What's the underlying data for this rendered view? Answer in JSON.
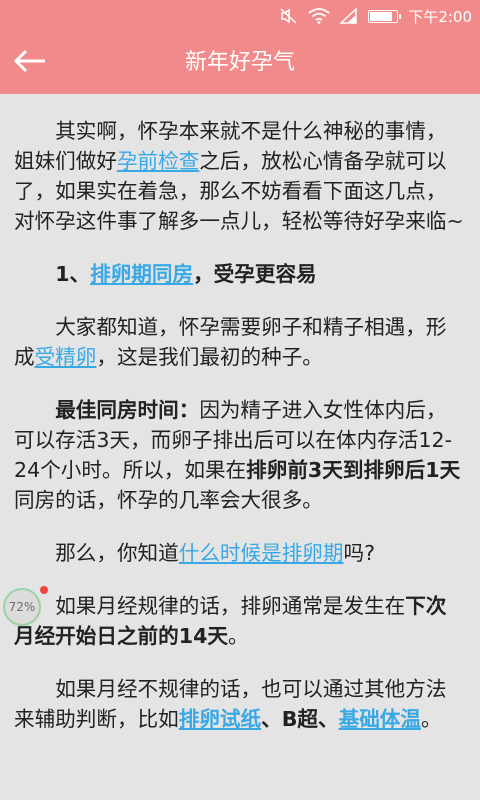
{
  "status_bar": {
    "time": "下午2:00",
    "icons": [
      "mute-icon",
      "wifi-icon",
      "signal-icon",
      "battery-icon"
    ]
  },
  "app_bar": {
    "title": "新年好孕气",
    "back_icon": "back-arrow-icon",
    "background": "#f18a8a"
  },
  "article": {
    "p1": {
      "a": "其实啊，怀孕本来就不是什么神秘的事情，姐妹们做好",
      "link": "孕前检查",
      "b": "之后，放松心情备孕就可以了，如果实在着急，那么不妨看看下面这几点，对怀孕这件事了解多一点儿，轻松等待好孕来临~"
    },
    "h1": {
      "prefix": "1、",
      "link": "排卵期同房",
      "suffix": "，受孕更容易"
    },
    "p2": {
      "a": "大家都知道，怀孕需要卵子和精子相遇，形成",
      "link": "受精卵",
      "b": "，这是我们最初的种子。"
    },
    "p3": {
      "bold1": "最佳同房时间：",
      "a": "因为精子进入女性体内后，可以存活3天，而卵子排出后可以在体内存活12-24个小时。所以，如果在",
      "bold2": "排卵前3天到排卵后1天",
      "b": "同房的话，怀孕的几率会大很多。"
    },
    "p4": {
      "a": "那么，你知道",
      "link": "什么时候是排卵期",
      "b": "吗?"
    },
    "p5": {
      "a": "如果月经规律的话，排卵通常是发生在",
      "bold": "下次月经开始日之前的14天",
      "b": "。"
    },
    "p6": {
      "a": "如果月经不规律的话，也可以通过其他方法来辅助判断，比如",
      "link1": "排卵试纸",
      "sep1": "、",
      "bold": "B超",
      "sep2": "、",
      "link2": "基础体温",
      "b": "。"
    }
  },
  "floating_badge": {
    "label": "72%"
  },
  "colors": {
    "link": "#39a9e6",
    "accent": "#f18a8a",
    "badge_dot": "#f0443c"
  }
}
